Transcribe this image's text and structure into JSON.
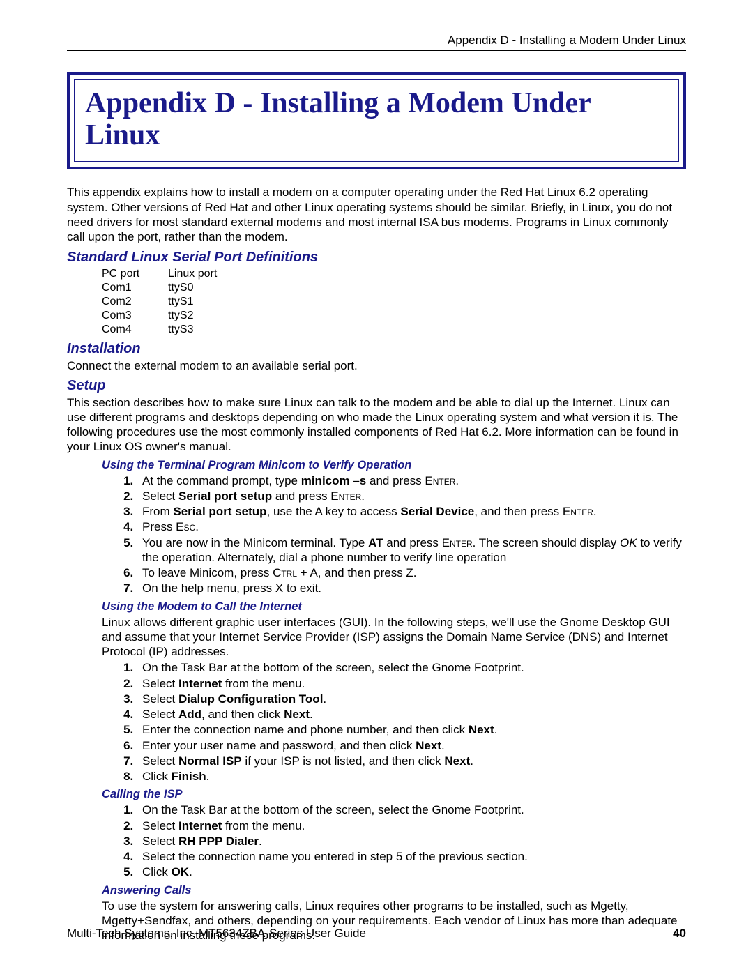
{
  "header": "Appendix D - Installing a Modem Under Linux",
  "title": "Appendix D - Installing a Modem Under Linux",
  "intro": "This appendix explains how to install a modem on a computer operating under the Red Hat Linux 6.2 operating system. Other versions of Red Hat and other Linux operating systems should be similar. Briefly, in Linux, you do not need drivers for most standard external modems and most internal ISA bus modems. Programs in Linux commonly call upon the port, rather than the modem.",
  "sec1": {
    "heading": "Standard Linux Serial Port Definitions",
    "tableHeader": {
      "c1": "PC port",
      "c2": "Linux port"
    },
    "rows": [
      {
        "c1": "Com1",
        "c2": "ttyS0"
      },
      {
        "c1": "Com2",
        "c2": "ttyS1"
      },
      {
        "c1": "Com3",
        "c2": "ttyS2"
      },
      {
        "c1": "Com4",
        "c2": "ttyS3"
      }
    ]
  },
  "sec2": {
    "heading": "Installation",
    "text": "Connect the external modem to an available serial port."
  },
  "sec3": {
    "heading": "Setup",
    "text": "This section describes how to make sure Linux can talk to the modem and be able to dial up the Internet. Linux can use different programs and desktops depending on who made the Linux operating system and what version it is. The following procedures use the most commonly installed components of Red Hat 6.2. More information can be found in your Linux OS owner's manual."
  },
  "sub1": {
    "heading": "Using the Terminal Program Minicom to Verify Operation",
    "items": [
      "At the command prompt, type <b>minicom –s</b> and press E<span class='sc'>nter</span>.",
      "Select <b>Serial port setup</b> and press E<span class='sc'>nter</span>.",
      "From <b>Serial port setup</b>, use the A key to access <b>Serial Device</b>, and then press E<span class='sc'>nter</span>.",
      "Press E<span class='sc'>sc</span>.",
      "You are now in the Minicom terminal. Type <b>AT</b> and press E<span class='sc'>nter</span>. The screen should display <em class='i'>OK</em> to verify the operation. Alternately, dial a phone number to verify line operation",
      "To leave Minicom, press C<span class='sc'>trl</span> + A, and then press Z.",
      "On the help menu, press X to exit."
    ]
  },
  "sub2": {
    "heading": "Using the Modem to Call the Internet",
    "intro": "Linux allows different graphic user interfaces (GUI). In the following steps, we'll use the Gnome Desktop GUI and assume that your Internet Service Provider (ISP) assigns the Domain Name Service (DNS) and Internet Protocol (IP) addresses.",
    "items": [
      "On the Task Bar at the bottom of the screen, select the Gnome Footprint.",
      "Select <b>Internet</b> from the menu.",
      "Select <b>Dialup Configuration Tool</b>.",
      "Select <b>Add</b>, and then click <b>Next</b>.",
      "Enter the connection name and phone number, and then click <b>Next</b>.",
      "Enter your user name and password, and then click <b>Next</b>.",
      "Select <b>Normal ISP</b> if your ISP is not listed, and then click <b>Next</b>.",
      "Click <b>Finish</b>."
    ]
  },
  "sub3": {
    "heading": "Calling the ISP",
    "items": [
      "On the Task Bar at the bottom of the screen, select the Gnome Footprint.",
      "Select <b>Internet</b> from the menu.",
      "Select <b>RH PPP Dialer</b>.",
      "Select the connection name you entered in step 5 of the previous section.",
      "Click <b>OK</b>."
    ]
  },
  "sub4": {
    "heading": "Answering Calls",
    "text": "To use the system for answering calls, Linux requires other programs to be installed, such as Mgetty, Mgetty+Sendfax, and others, depending on your requirements. Each vendor of Linux has more than adequate information on installing these programs."
  },
  "footer": {
    "left": "Multi-Tech Systems, Inc. MT5634ZBA-Series User Guide",
    "page": "40"
  }
}
